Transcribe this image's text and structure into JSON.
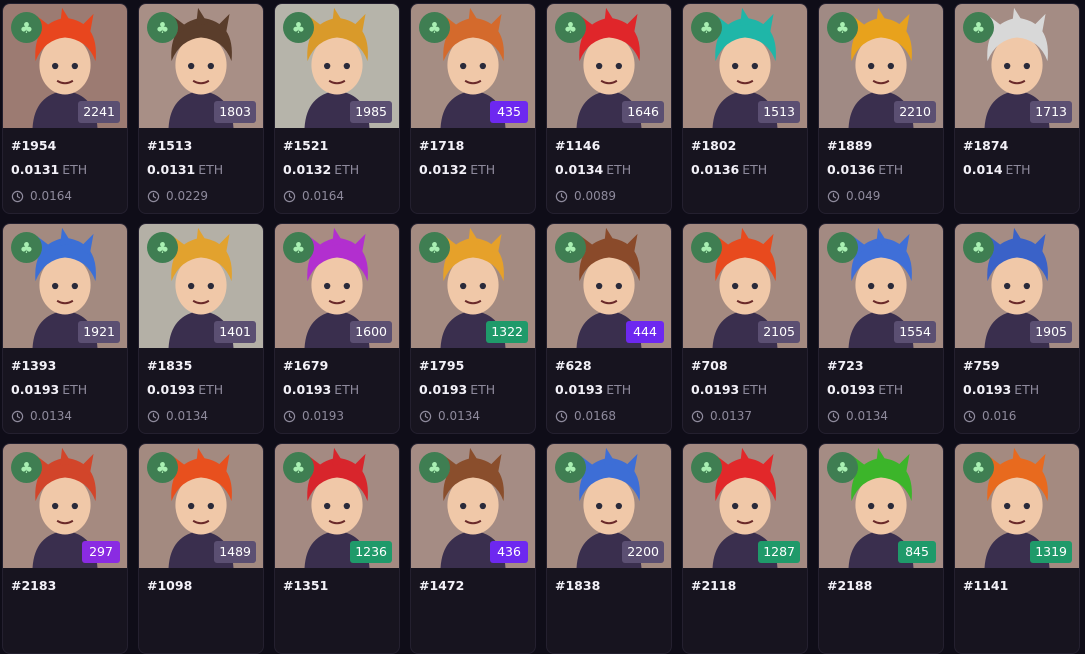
{
  "currency": "ETH",
  "colors": {
    "badge_default": "#5b4f72",
    "badge_purple": "#6d28f0",
    "badge_violet": "#8a2be2",
    "badge_green": "#1f9a6a"
  },
  "cards": [
    {
      "token": "#1954",
      "price": "0.0131",
      "last": "0.0164",
      "rank": "2241",
      "badge": "badge_default",
      "hair": "#e8461e",
      "bg": "#9c7b72"
    },
    {
      "token": "#1513",
      "price": "0.0131",
      "last": "0.0229",
      "rank": "1803",
      "badge": "badge_default",
      "hair": "#5a3d2b",
      "bg": "#a88f86"
    },
    {
      "token": "#1521",
      "price": "0.0132",
      "last": "0.0164",
      "rank": "1985",
      "badge": "badge_default",
      "hair": "#d99a2a",
      "bg": "#b6b4aa"
    },
    {
      "token": "#1718",
      "price": "0.0132",
      "last": "",
      "rank": "435",
      "badge": "badge_purple",
      "hair": "#d46a2c",
      "bg": "#a58d83"
    },
    {
      "token": "#1146",
      "price": "0.0134",
      "last": "0.0089",
      "rank": "1646",
      "badge": "badge_default",
      "hair": "#e0262a",
      "bg": "#a08a82"
    },
    {
      "token": "#1802",
      "price": "0.0136",
      "last": "",
      "rank": "1513",
      "badge": "badge_default",
      "hair": "#1fb6a8",
      "bg": "#a58a80"
    },
    {
      "token": "#1889",
      "price": "0.0136",
      "last": "0.049",
      "rank": "2210",
      "badge": "badge_default",
      "hair": "#e8a21c",
      "bg": "#a08a84"
    },
    {
      "token": "#1874",
      "price": "0.014",
      "last": "",
      "rank": "1713",
      "badge": "badge_default",
      "hair": "#d8d8d8",
      "bg": "#a48c84"
    },
    {
      "token": "#1393",
      "price": "0.0193",
      "last": "0.0134",
      "rank": "1921",
      "badge": "badge_default",
      "hair": "#3b6fd6",
      "bg": "#a38a80"
    },
    {
      "token": "#1835",
      "price": "0.0193",
      "last": "0.0134",
      "rank": "1401",
      "badge": "badge_default",
      "hair": "#e2a22e",
      "bg": "#b4b0a6"
    },
    {
      "token": "#1679",
      "price": "0.0193",
      "last": "0.0193",
      "rank": "1600",
      "badge": "badge_default",
      "hair": "#b22fcf",
      "bg": "#a88c82"
    },
    {
      "token": "#1795",
      "price": "0.0193",
      "last": "0.0134",
      "rank": "1322",
      "badge": "badge_green",
      "hair": "#e6a12a",
      "bg": "#a48b81"
    },
    {
      "token": "#628",
      "price": "0.0193",
      "last": "0.0168",
      "rank": "444",
      "badge": "badge_purple",
      "hair": "#8a4a2a",
      "bg": "#a58c82"
    },
    {
      "token": "#708",
      "price": "0.0193",
      "last": "0.0137",
      "rank": "2105",
      "badge": "badge_default",
      "hair": "#e84a1e",
      "bg": "#a48a80"
    },
    {
      "token": "#723",
      "price": "0.0193",
      "last": "0.0134",
      "rank": "1554",
      "badge": "badge_default",
      "hair": "#3f6fd8",
      "bg": "#a38a82"
    },
    {
      "token": "#759",
      "price": "0.0193",
      "last": "0.016",
      "rank": "1905",
      "badge": "badge_default",
      "hair": "#3a62c8",
      "bg": "#a58c84"
    },
    {
      "token": "#2183",
      "price": "",
      "last": "",
      "rank": "297",
      "badge": "badge_violet",
      "hair": "#d2452a",
      "bg": "#a58a80"
    },
    {
      "token": "#1098",
      "price": "",
      "last": "",
      "rank": "1489",
      "badge": "badge_default",
      "hair": "#e8501e",
      "bg": "#a38a80"
    },
    {
      "token": "#1351",
      "price": "",
      "last": "",
      "rank": "1236",
      "badge": "badge_green",
      "hair": "#d8252c",
      "bg": "#a48a82"
    },
    {
      "token": "#1472",
      "price": "",
      "last": "",
      "rank": "436",
      "badge": "badge_purple",
      "hair": "#8a4e2c",
      "bg": "#a58c84"
    },
    {
      "token": "#1838",
      "price": "",
      "last": "",
      "rank": "2200",
      "badge": "badge_default",
      "hair": "#3d6ed6",
      "bg": "#a38a80"
    },
    {
      "token": "#2118",
      "price": "",
      "last": "",
      "rank": "1287",
      "badge": "badge_green",
      "hair": "#e2282a",
      "bg": "#a48a82"
    },
    {
      "token": "#2188",
      "price": "",
      "last": "",
      "rank": "845",
      "badge": "badge_green",
      "hair": "#3cb52a",
      "bg": "#a58c84"
    },
    {
      "token": "#1141",
      "price": "",
      "last": "",
      "rank": "1319",
      "badge": "badge_green",
      "hair": "#e86a1e",
      "bg": "#a48a80"
    }
  ]
}
